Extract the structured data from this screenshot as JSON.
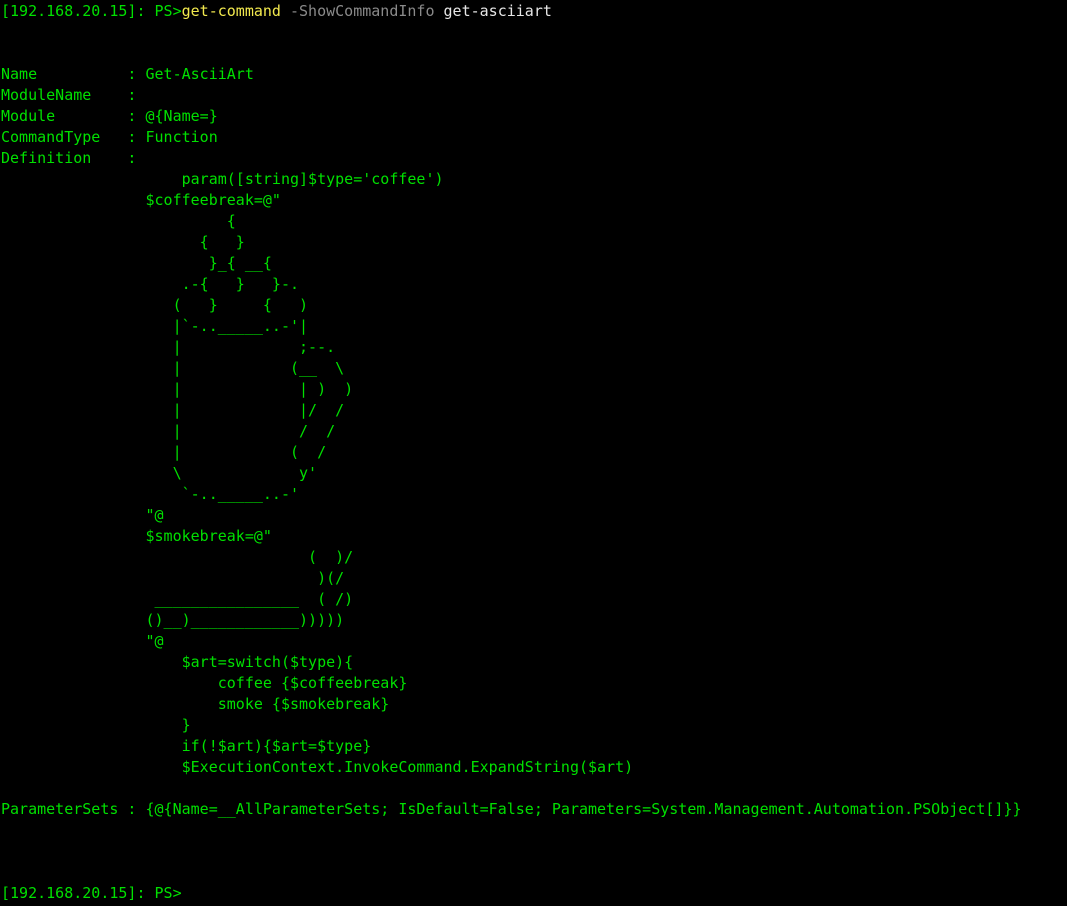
{
  "colors": {
    "background": "#000000",
    "output_green": "#00e000",
    "command_yellow": "#f2e94e",
    "parameter_gray": "#8a8a8a",
    "argument_white": "#e6e6e6"
  },
  "command_line": {
    "prompt": "[192.168.20.15]: PS>",
    "command": "get-command",
    "parameter": " -ShowCommandInfo",
    "argument": " get-asciiart"
  },
  "output_lines": [
    "Name          : Get-AsciiArt",
    "ModuleName    :",
    "Module        : @{Name=}",
    "CommandType   : Function",
    "Definition    :",
    "                    param([string]$type='coffee')",
    "                $coffeebreak=@\"",
    "                         {",
    "                      {   }",
    "                       }_{ __{",
    "                    .-{   }   }-.",
    "                   (   }     {   )",
    "                   |`-.._____..-'|",
    "                   |             ;--.",
    "                   |            (__  \\",
    "                   |             | )  )",
    "                   |             |/  /",
    "                   |             /  /",
    "                   |            (  /",
    "                   \\             y'",
    "                    `-.._____..-'",
    "                \"@",
    "                $smokebreak=@\"",
    "                                  (  )/",
    "                                   )(/",
    "                 ________________  ( /)",
    "                ()__)____________)))))",
    "                \"@",
    "                    $art=switch($type){",
    "                        coffee {$coffeebreak}",
    "                        smoke {$smokebreak}",
    "                    }",
    "                    if(!$art){$art=$type}",
    "                    $ExecutionContext.InvokeCommand.ExpandString($art)",
    "",
    "ParameterSets : {@{Name=__AllParameterSets; IsDefault=False; Parameters=System.Management.Automation.PSObject[]}}"
  ],
  "final_prompt": "[192.168.20.15]: PS>"
}
